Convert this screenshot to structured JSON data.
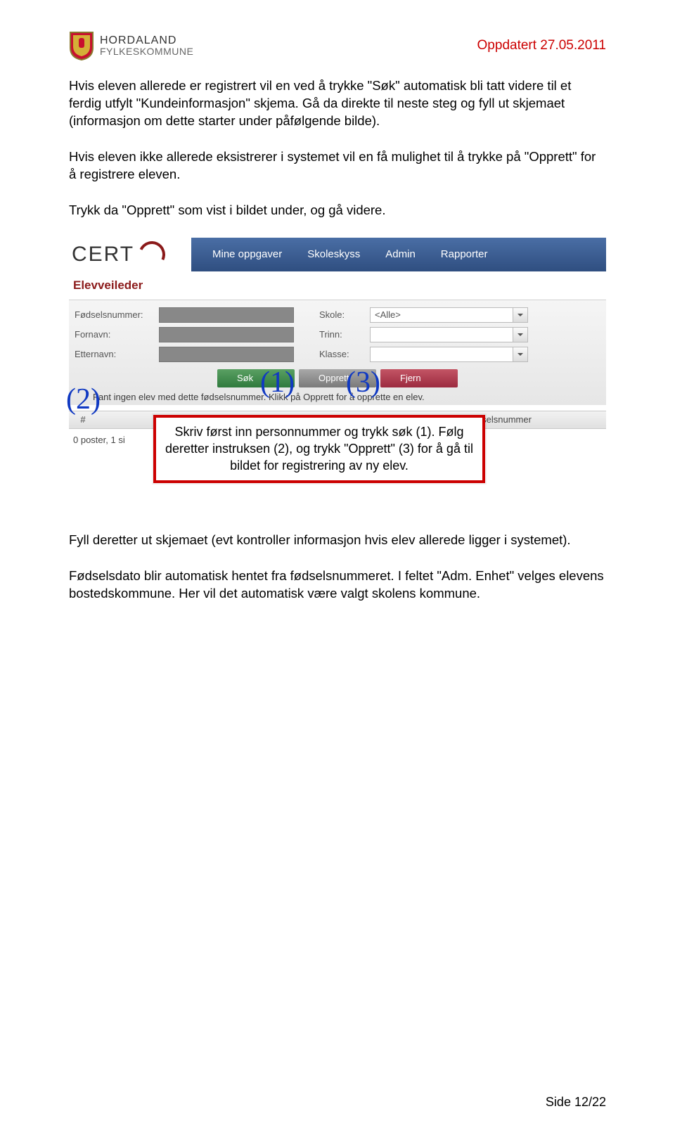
{
  "header": {
    "org_line1": "HORDALAND",
    "org_line2": "FYLKESKOMMUNE",
    "updated": "Oppdatert 27.05.2011"
  },
  "para": {
    "p1": "Hvis eleven allerede er registrert vil en ved å trykke \"Søk\" automatisk bli tatt videre til et ferdig utfylt \"Kundeinformasjon\" skjema. Gå da direkte til neste steg og fyll ut skjemaet (informasjon om dette starter under påfølgende bilde).",
    "p2": "Hvis eleven ikke allerede eksistrerer i systemet vil en få mulighet til å trykke på \"Opprett\" for å registrere eleven.",
    "p3": "Trykk da \"Opprett\" som vist i bildet under, og gå videre.",
    "p4": "Fyll deretter ut skjemaet (evt kontroller informasjon hvis elev allerede ligger i systemet).",
    "p5": "Fødselsdato blir automatisk hentet fra fødselsnummeret. I feltet \"Adm. Enhet\" velges elevens bostedskommune. Her vil det automatisk være valgt skolens kommune."
  },
  "app": {
    "logo": "CERT",
    "nav": [
      "Mine oppgaver",
      "Skoleskyss",
      "Admin",
      "Rapporter"
    ],
    "crumb": "Elevveileder",
    "labels": {
      "fnr": "Fødselsnummer:",
      "fornavn": "Fornavn:",
      "etternavn": "Etternavn:",
      "skole": "Skole:",
      "trinn": "Trinn:",
      "klasse": "Klasse:"
    },
    "skole_value": "<Alle>",
    "buttons": {
      "sok": "Søk",
      "opprett": "Opprett",
      "fjern": "Fjern"
    },
    "msg": "Fant ingen elev med dette fødselsnummer. Klikk på Opprett for å opprette en elev.",
    "table": {
      "c1": "#",
      "c3": "Fødselsnummer"
    },
    "pager": "0 poster, 1 si",
    "callout": "Skriv først inn personnummer og trykk søk (1). Følg deretter instruksen (2), og trykk \"Opprett\" (3) for å gå til bildet for registrering av ny elev.",
    "anno": {
      "a1": "(1)",
      "a2": "(2)",
      "a3": "(3)"
    }
  },
  "footer": "Side 12/22"
}
